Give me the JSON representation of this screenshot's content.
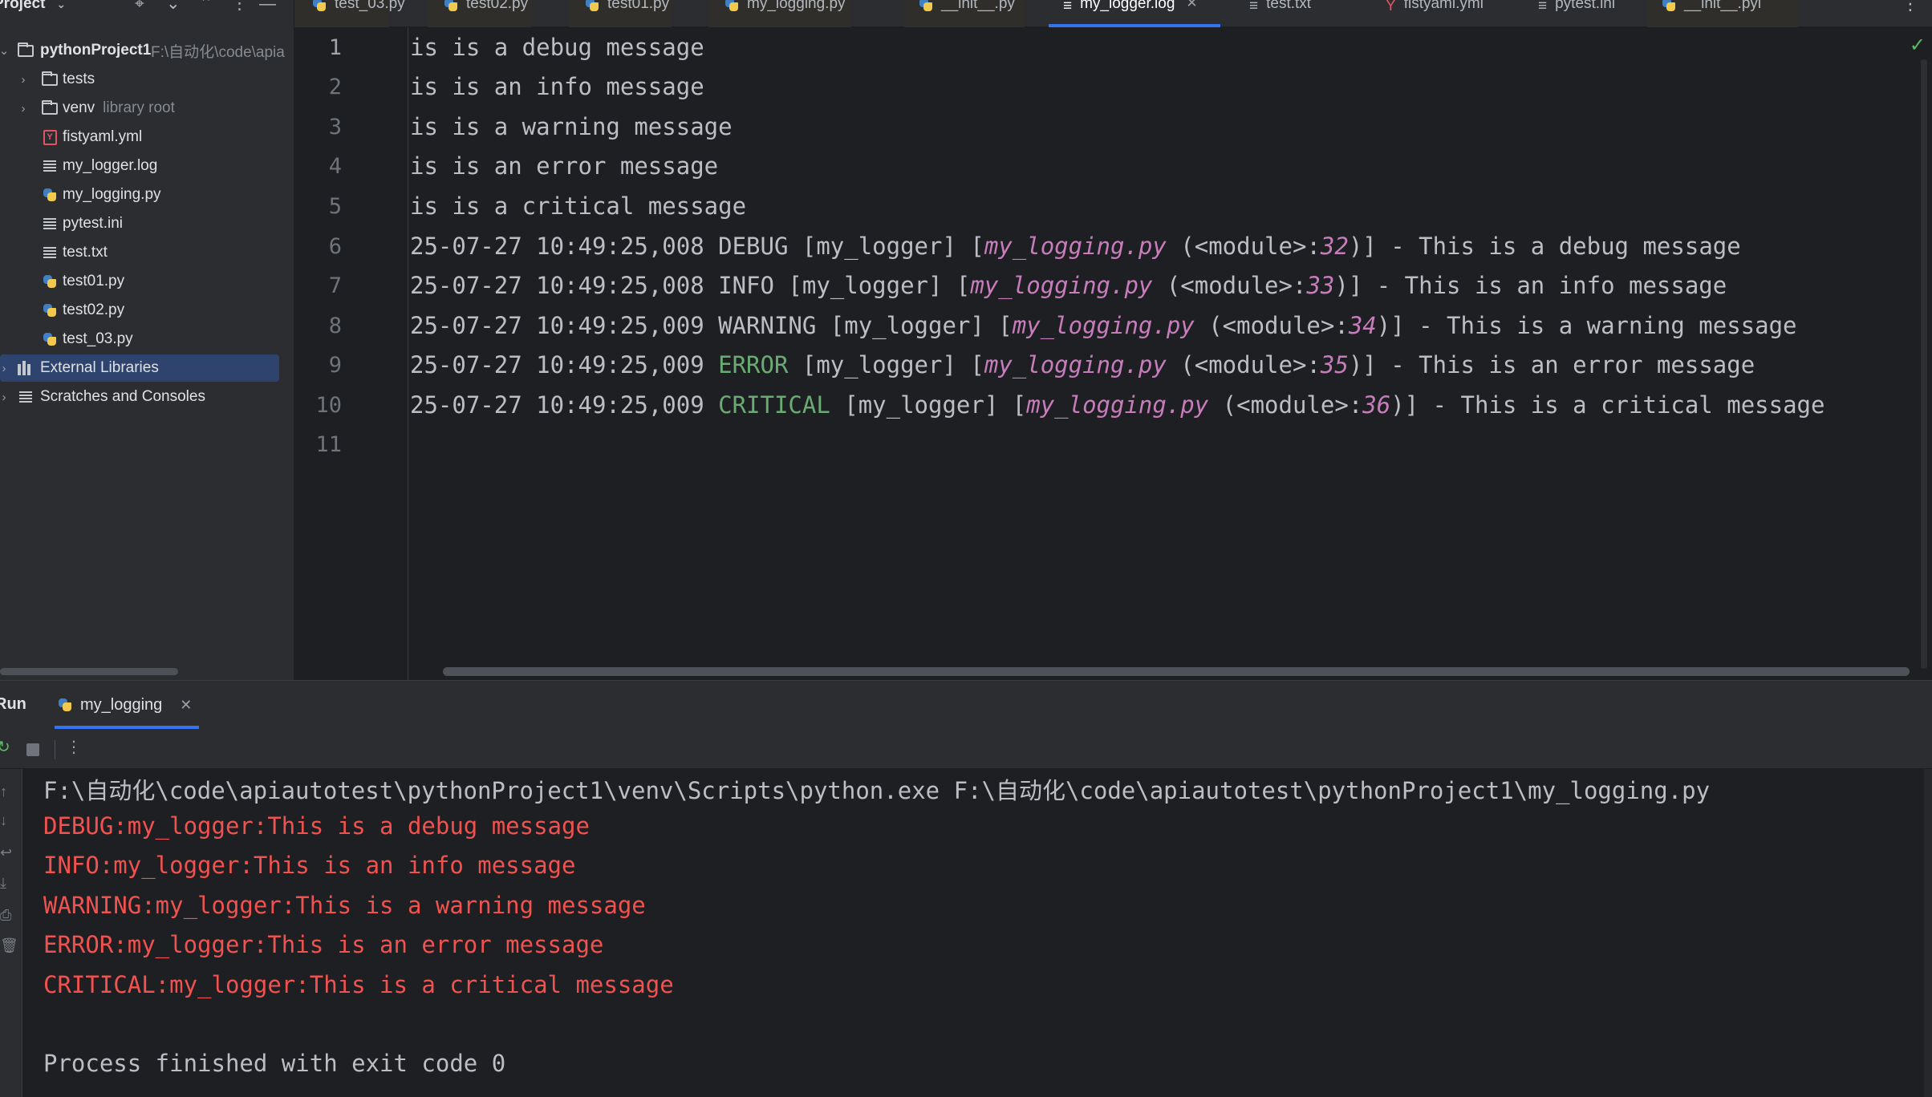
{
  "sidebar": {
    "title": "Project",
    "project_name": "pythonProject1",
    "project_path": "F:\\自动化\\code\\apia",
    "items": [
      {
        "label": "tests",
        "hint": ""
      },
      {
        "label": "venv",
        "hint": "library root"
      },
      {
        "label": "fistyaml.yml"
      },
      {
        "label": "my_logger.log"
      },
      {
        "label": "my_logging.py"
      },
      {
        "label": "pytest.ini"
      },
      {
        "label": "test.txt"
      },
      {
        "label": "test01.py"
      },
      {
        "label": "test02.py"
      },
      {
        "label": "test_03.py"
      },
      {
        "label": "External Libraries"
      },
      {
        "label": "Scratches and Consoles"
      }
    ]
  },
  "tabs": [
    {
      "label": "test_03.py"
    },
    {
      "label": "test02.py"
    },
    {
      "label": "test01.py"
    },
    {
      "label": "my_logging.py"
    },
    {
      "label": "__init__.py"
    },
    {
      "label": "my_logger.log"
    },
    {
      "label": "test.txt"
    },
    {
      "label": "fistyaml.yml"
    },
    {
      "label": "pytest.ini"
    },
    {
      "label": "__init__.pyi"
    }
  ],
  "editor": {
    "line_numbers": [
      "1",
      "2",
      "3",
      "4",
      "5",
      "6",
      "7",
      "8",
      "9",
      "10",
      "11"
    ],
    "plain_lines": [
      "is is a debug message",
      "is is an info message",
      "is is a warning message",
      "is is an error message",
      "is is a critical message"
    ],
    "log_lines": [
      {
        "ts": "25-07-27 10:49:25,008 ",
        "level": "DEBUG",
        "pre": " [my_logger] [",
        "file": "my_logging.py",
        "mid": " (<module>:",
        "lineno": "32",
        "msg": ")] - This is a debug message"
      },
      {
        "ts": "25-07-27 10:49:25,008 ",
        "level": "INFO",
        "pre": " [my_logger] [",
        "file": "my_logging.py",
        "mid": " (<module>:",
        "lineno": "33",
        "msg": ")] - This is an info message"
      },
      {
        "ts": "25-07-27 10:49:25,009 ",
        "level": "WARNING",
        "pre": " [my_logger] [",
        "file": "my_logging.py",
        "mid": " (<module>:",
        "lineno": "34",
        "msg": ")] - This is a warning message"
      },
      {
        "ts": "25-07-27 10:49:25,009 ",
        "level": "ERROR",
        "pre": " [my_logger] [",
        "file": "my_logging.py",
        "mid": " (<module>:",
        "lineno": "35",
        "msg": ")] - This is an error message"
      },
      {
        "ts": "25-07-27 10:49:25,009 ",
        "level": "CRITICAL",
        "pre": " [my_logger] [",
        "file": "my_logging.py",
        "mid": " (<module>:",
        "lineno": "36",
        "msg": ")] - This is a critical message"
      }
    ]
  },
  "run": {
    "title": "Run",
    "tab_label": "my_logging",
    "console": {
      "command": "F:\\自动化\\code\\apiautotest\\pythonProject1\\venv\\Scripts\\python.exe F:\\自动化\\code\\apiautotest\\pythonProject1\\my_logging.py",
      "output": [
        "DEBUG:my_logger:This is a debug message",
        "INFO:my_logger:This is an info message",
        "WARNING:my_logger:This is a warning message",
        "ERROR:my_logger:This is an error message",
        "CRITICAL:my_logger:This is a critical message"
      ],
      "exit": "Process finished with exit code 0"
    }
  },
  "colors": {
    "accent": "#3574f0",
    "selected_row": "#2e436e",
    "stderr_red": "#f0524f",
    "filename_pink": "#c77dbb",
    "level_green": "#6aab73"
  }
}
